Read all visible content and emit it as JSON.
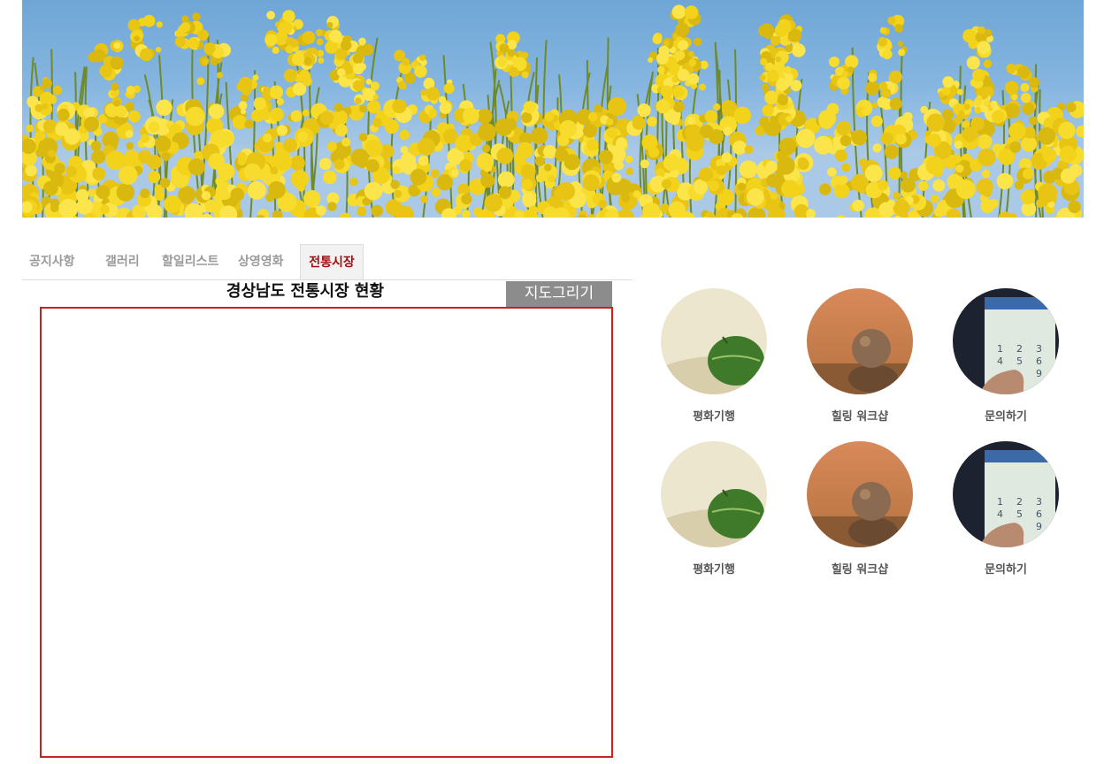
{
  "banner": {
    "subject": "yellow rapeseed flower field under blue sky"
  },
  "tabs": [
    {
      "label": "공지사항"
    },
    {
      "label": "갤러리"
    },
    {
      "label": "할일리스트"
    },
    {
      "label": "상영영화"
    },
    {
      "label": "전통시장",
      "active": true
    }
  ],
  "market": {
    "title": "경상남도 전통시장 현황",
    "draw_button": "지도그리기"
  },
  "menu": [
    {
      "label": "평화기행",
      "icon": "leaf-icon"
    },
    {
      "label": "힐링 워크샵",
      "icon": "stone-icon"
    },
    {
      "label": "문의하기",
      "icon": "phone-icon"
    },
    {
      "label": "평화기행",
      "icon": "leaf-icon"
    },
    {
      "label": "힐링 워크샵",
      "icon": "stone-icon"
    },
    {
      "label": "문의하기",
      "icon": "phone-icon"
    }
  ],
  "colors": {
    "active_tab": "#a01010",
    "map_border": "#cc1f1f",
    "button_bg": "#8c8c8c"
  }
}
